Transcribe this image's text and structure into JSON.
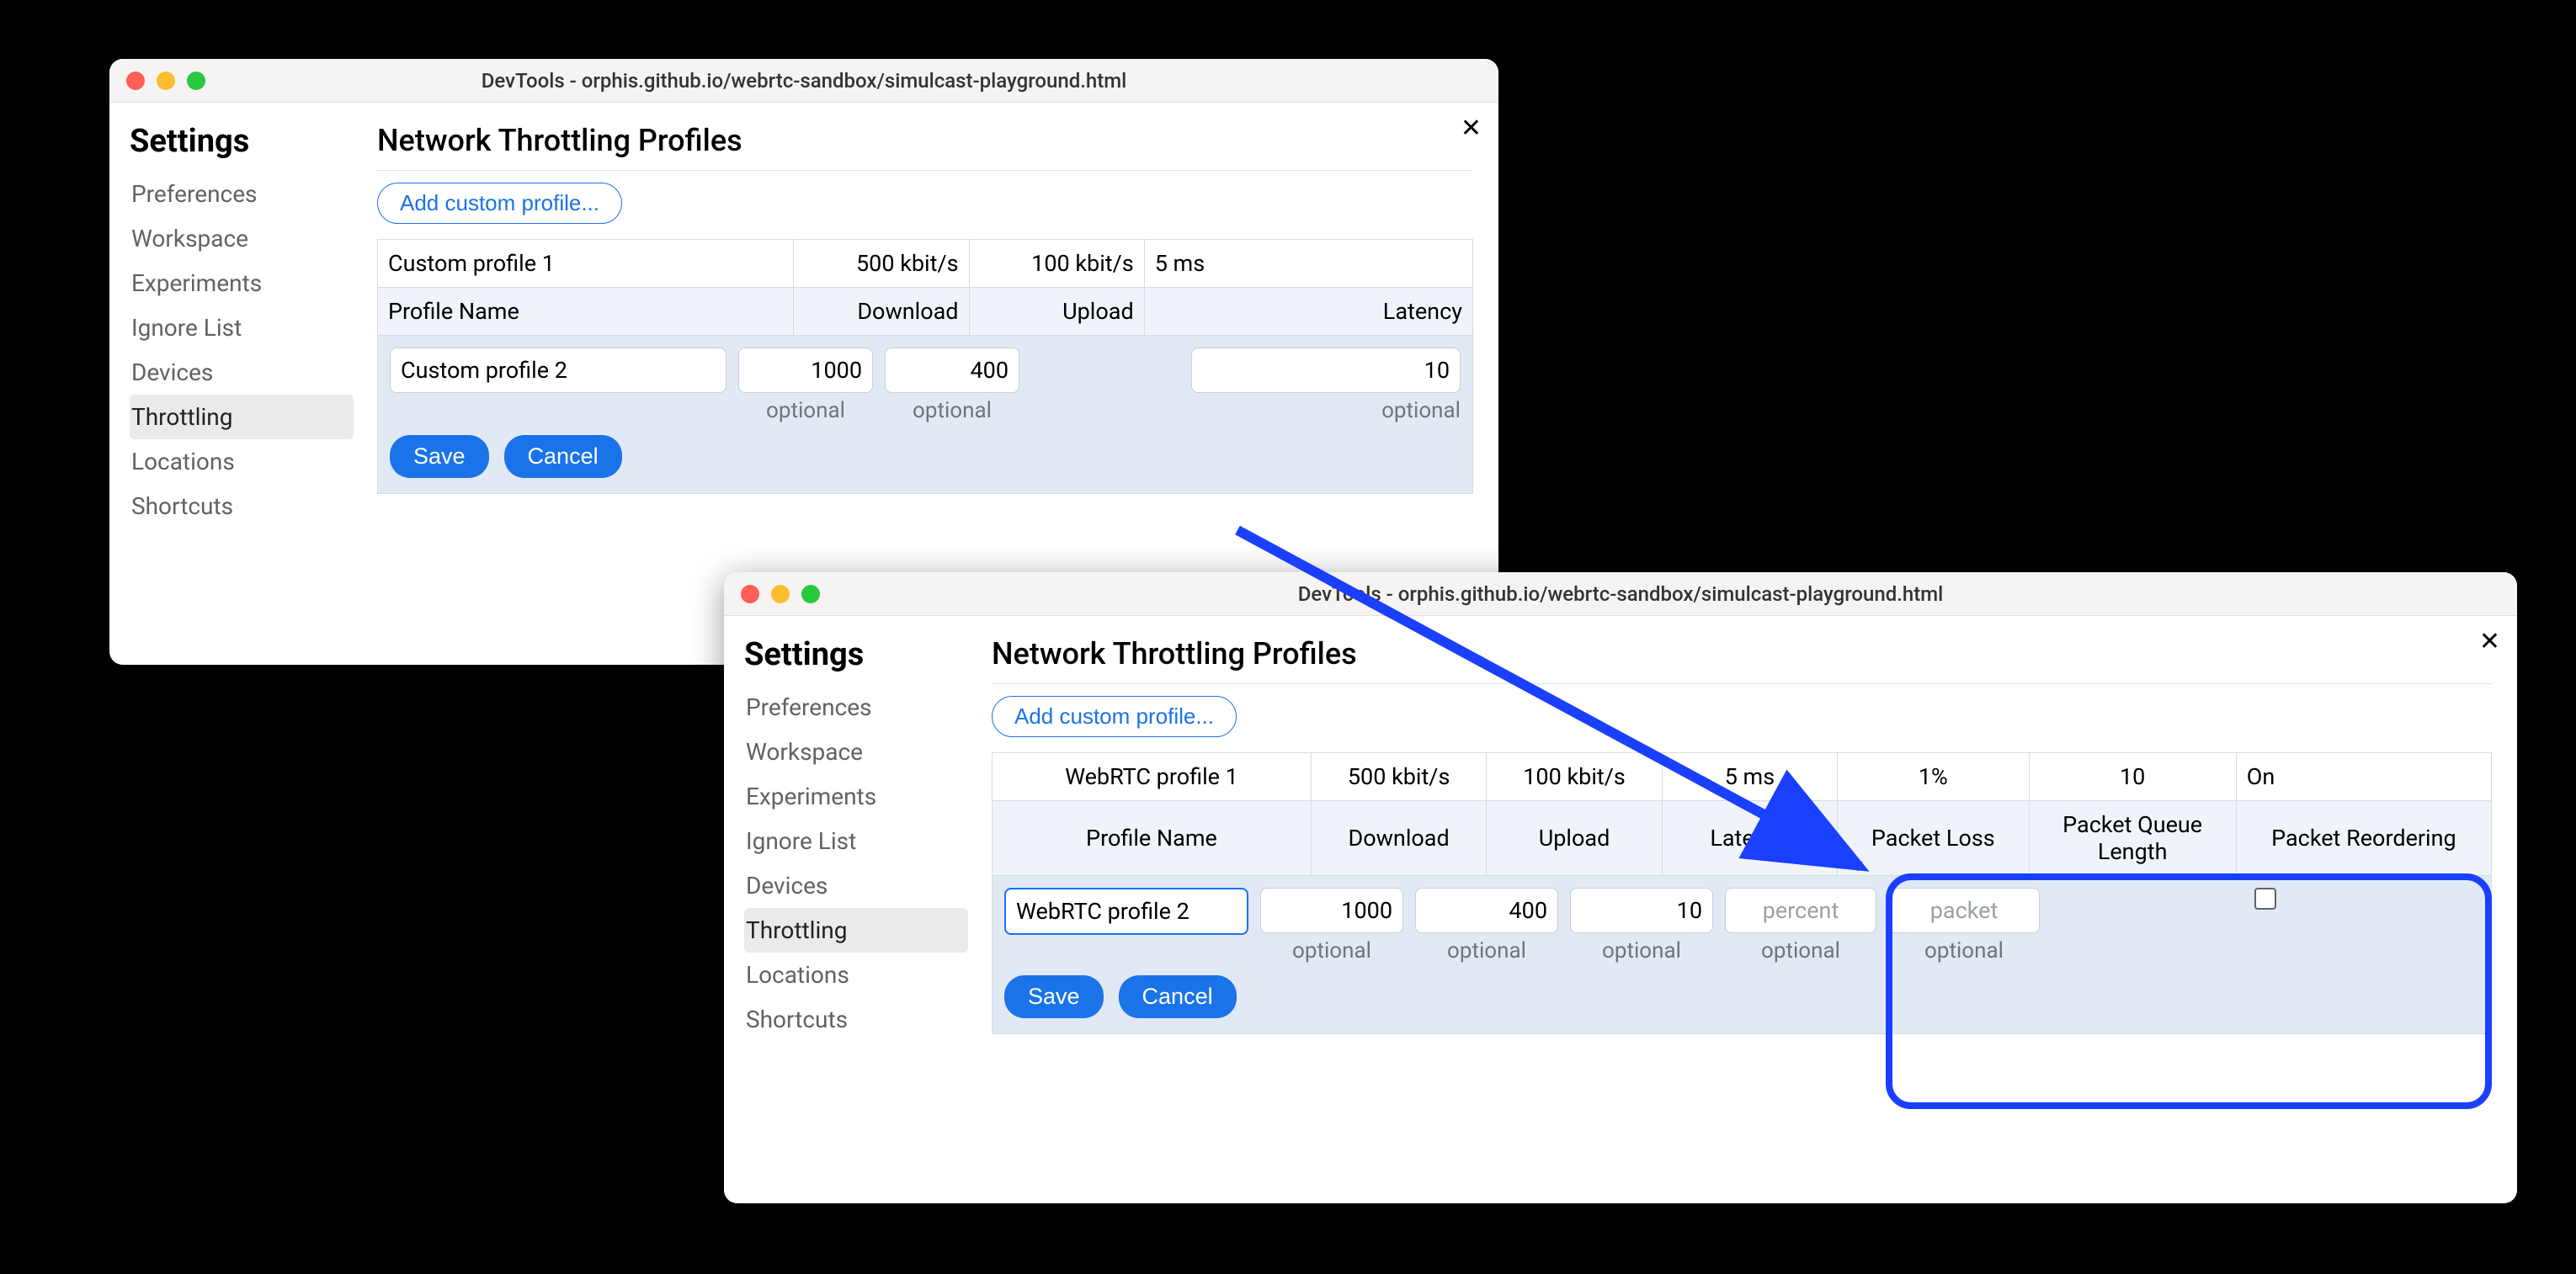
{
  "windowA": {
    "title": "DevTools - orphis.github.io/webrtc-sandbox/simulcast-playground.html",
    "sidebar_heading": "Settings",
    "nav": [
      "Preferences",
      "Workspace",
      "Experiments",
      "Ignore List",
      "Devices",
      "Throttling",
      "Locations",
      "Shortcuts"
    ],
    "nav_selected_index": 5,
    "heading": "Network Throttling Profiles",
    "add_button": "Add custom profile...",
    "columns": [
      "Profile Name",
      "Download",
      "Upload",
      "Latency"
    ],
    "row": {
      "name": "Custom profile 1",
      "download": "500 kbit/s",
      "upload": "100 kbit/s",
      "latency": "5 ms"
    },
    "edit": {
      "name": "Custom profile 2",
      "download": "1000",
      "upload": "400",
      "latency": "10"
    },
    "optional_label": "optional",
    "save": "Save",
    "cancel": "Cancel"
  },
  "windowB": {
    "title": "DevTools - orphis.github.io/webrtc-sandbox/simulcast-playground.html",
    "sidebar_heading": "Settings",
    "nav": [
      "Preferences",
      "Workspace",
      "Experiments",
      "Ignore List",
      "Devices",
      "Throttling",
      "Locations",
      "Shortcuts"
    ],
    "nav_selected_index": 5,
    "heading": "Network Throttling Profiles",
    "add_button": "Add custom profile...",
    "columns": [
      "Profile Name",
      "Download",
      "Upload",
      "Latency",
      "Packet Loss",
      "Packet Queue Length",
      "Packet Reordering"
    ],
    "row": {
      "name": "WebRTC profile 1",
      "download": "500 kbit/s",
      "upload": "100 kbit/s",
      "latency": "5 ms",
      "packet_loss": "1%",
      "packet_queue": "10",
      "packet_reorder": "On"
    },
    "edit": {
      "name": "WebRTC profile 2",
      "download": "1000",
      "upload": "400",
      "latency": "10",
      "packet_loss_placeholder": "percent",
      "packet_queue_placeholder": "packet"
    },
    "optional_label": "optional",
    "save": "Save",
    "cancel": "Cancel"
  }
}
